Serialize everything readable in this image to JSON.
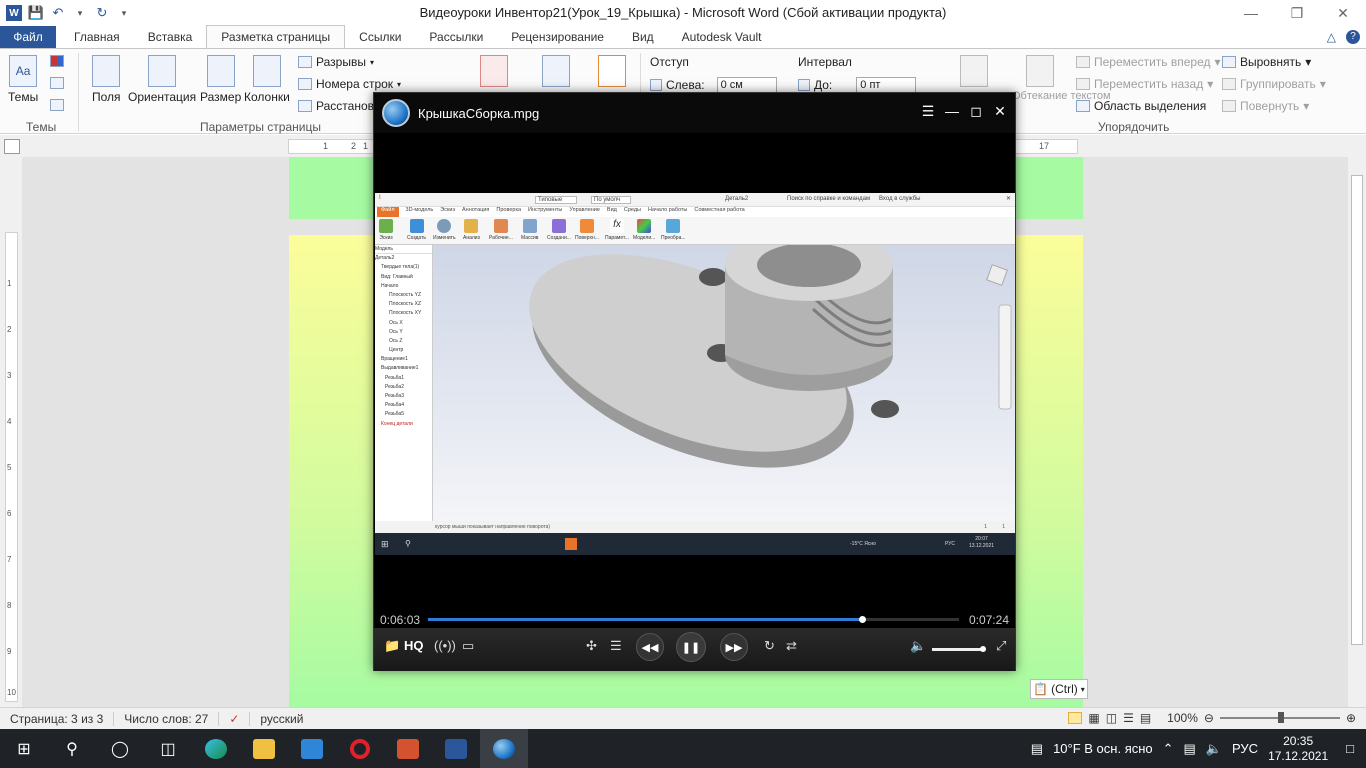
{
  "window": {
    "title": "Видеоуроки Инвентор21(Урок_19_Крышка)  -  Microsoft Word (Сбой активации продукта)"
  },
  "ribbon": {
    "tabs": [
      "Файл",
      "Главная",
      "Вставка",
      "Разметка страницы",
      "Ссылки",
      "Рассылки",
      "Рецензирование",
      "Вид",
      "Autodesk Vault"
    ],
    "active_tab": "Разметка страницы",
    "themes": {
      "button": "Темы",
      "group": "Темы"
    },
    "page_setup": {
      "margins": "Поля",
      "orientation": "Ориентация",
      "size": "Размер",
      "columns": "Колонки",
      "breaks": "Разрывы",
      "line_numbers": "Номера строк",
      "hyphenation": "Расстановк",
      "group": "Параметры страницы"
    },
    "paragraph": {
      "indent_label": "Отступ",
      "left_label": "Слева:",
      "left_value": "0 см",
      "spacing_label": "Интервал",
      "before_label": "До:",
      "before_value": "0 пт"
    },
    "arrange": {
      "wrap_text": "Обтекание текстом",
      "bring_forward": "Переместить вперед",
      "send_backward": "Переместить назад",
      "selection_pane": "Область выделения",
      "align": "Выровнять",
      "group_btn": "Группировать",
      "rotate": "Повернуть",
      "group": "Упорядочить"
    }
  },
  "ruler": {
    "h_marks": [
      "1",
      "2",
      "1",
      "17"
    ],
    "v_marks": [
      "1",
      "2",
      "3",
      "4",
      "5",
      "6",
      "7",
      "8",
      "9",
      "10"
    ]
  },
  "paste_options": {
    "label": "(Ctrl)"
  },
  "status": {
    "page": "Страница: 3 из 3",
    "words": "Число слов: 27",
    "language": "русский",
    "zoom": "100%"
  },
  "player": {
    "filename": "КрышкаСборка.mpg",
    "elapsed": "0:06:03",
    "total": "0:07:24",
    "progress_fraction": 0.818,
    "volume_fraction": 0.95,
    "hq_label": "HQ"
  },
  "inventor": {
    "doc_name": "Деталь2",
    "search_hint": "Поиск по справке и командам",
    "signin": "Вход в службы",
    "appearance": "Типовые",
    "material": "По умолч",
    "tabs": [
      "Файл",
      "3D-модель",
      "Эскиз",
      "Аннотация",
      "Проверка",
      "Инструменты",
      "Управление",
      "Вид",
      "Среды",
      "Начало работы",
      "Совместная работа"
    ],
    "tools": [
      "Эскиз",
      "Создать",
      "Изменить",
      "Анализ",
      "Рабочие...",
      "Массив",
      "Создани...",
      "Поверхн...",
      "Парамет...",
      "Модели...",
      "Преобра..."
    ],
    "browser_title": "Модель",
    "tree": [
      "Деталь2",
      "Твердые тела(1)",
      "Вид: Главный",
      "Начало",
      "Плоскость YZ",
      "Плоскость XZ",
      "Плоскость XY",
      "Ось X",
      "Ось Y",
      "Ось Z",
      "Центр",
      "Вращение1",
      "Выдавливание1",
      "Резьба1",
      "Резьба2",
      "Резьба3",
      "Резьба4",
      "Резьба5",
      "Конец детали"
    ],
    "status_text": "курсор мыши показывает направление поворота)",
    "status_right": [
      "1",
      "1"
    ],
    "tray_weather": "-15°C Ясно",
    "tray_lang": "РУС",
    "tray_time": "20:07",
    "tray_date": "13.12.2021"
  },
  "taskbar": {
    "weather": "10°F  В осн. ясно",
    "lang": "РУС",
    "time": "20:35",
    "date": "17.12.2021"
  },
  "colors": {
    "word_blue": "#2b579a",
    "page_green": "#a6fba2",
    "page_yellow": "#fbfd9a",
    "progress_blue": "#2f7cd6",
    "inventor_orange": "#e8732a"
  }
}
